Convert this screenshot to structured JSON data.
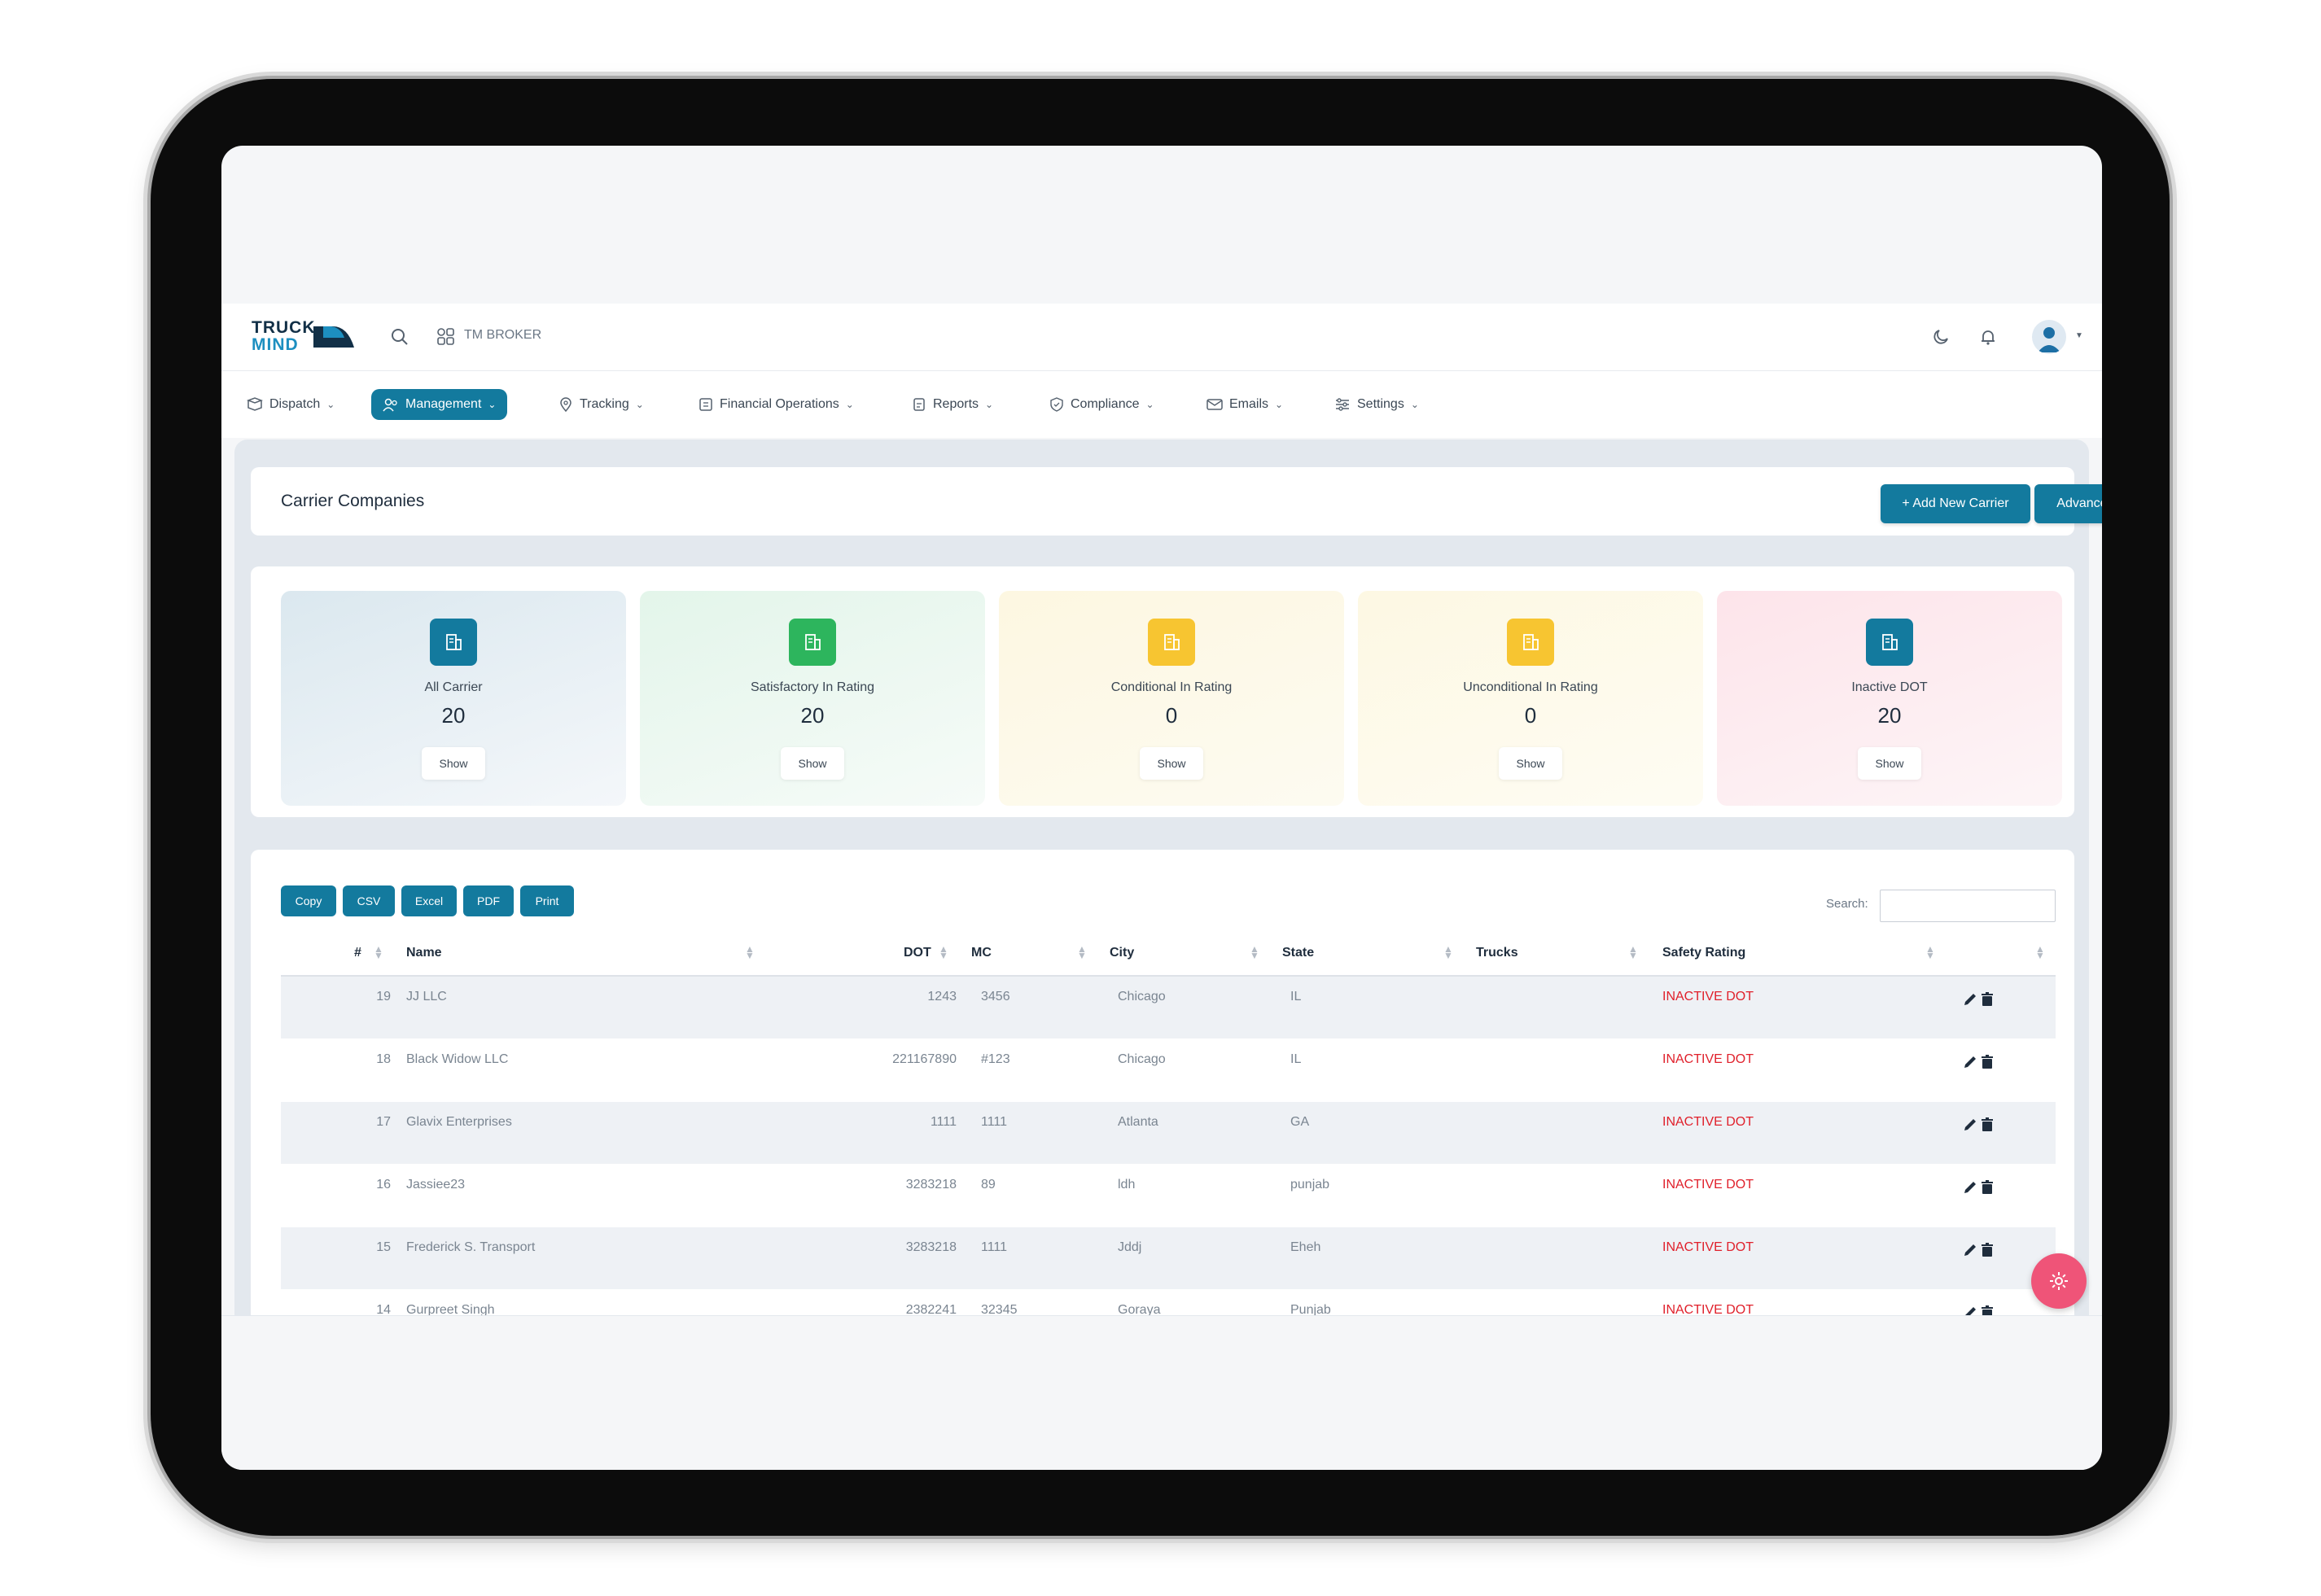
{
  "header": {
    "logo_line1": "TRUCK",
    "logo_line2": "MIND",
    "broker_label": "TM BROKER"
  },
  "nav": {
    "items": [
      {
        "label": "Dispatch",
        "icon": "truck-icon"
      },
      {
        "label": "Management",
        "icon": "people-icon",
        "active": true
      },
      {
        "label": "Tracking",
        "icon": "map-pin-icon"
      },
      {
        "label": "Financial Operations",
        "icon": "invoice-icon"
      },
      {
        "label": "Reports",
        "icon": "report-icon"
      },
      {
        "label": "Compliance",
        "icon": "shield-icon"
      },
      {
        "label": "Emails",
        "icon": "mail-icon"
      },
      {
        "label": "Settings",
        "icon": "sliders-icon"
      }
    ]
  },
  "page": {
    "title": "Carrier Companies",
    "add_button": "+ Add New Carrier",
    "advance_button": "Advance Search"
  },
  "stats": [
    {
      "label": "All Carrier",
      "value": "20",
      "button": "Show",
      "color": "#137a9e"
    },
    {
      "label": "Satisfactory In Rating",
      "value": "20",
      "button": "Show",
      "color": "#2db55d"
    },
    {
      "label": "Conditional In Rating",
      "value": "0",
      "button": "Show",
      "color": "#f7c531"
    },
    {
      "label": "Unconditional In Rating",
      "value": "0",
      "button": "Show",
      "color": "#f7c531"
    },
    {
      "label": "Inactive DOT",
      "value": "20",
      "button": "Show",
      "color": "#137a9e"
    }
  ],
  "table": {
    "export_buttons": [
      "Copy",
      "CSV",
      "Excel",
      "PDF",
      "Print"
    ],
    "search_label": "Search:",
    "columns": [
      "#",
      "Name",
      "DOT",
      "MC",
      "City",
      "State",
      "Trucks",
      "Safety Rating"
    ],
    "rows": [
      {
        "num": "19",
        "name": "JJ LLC",
        "dot": "1243",
        "mc": "3456",
        "city": "Chicago",
        "state": "IL",
        "trucks": "",
        "rating": "INACTIVE DOT"
      },
      {
        "num": "18",
        "name": "Black Widow LLC",
        "dot": "221167890",
        "mc": "#123",
        "city": "Chicago",
        "state": "IL",
        "trucks": "",
        "rating": "INACTIVE DOT"
      },
      {
        "num": "17",
        "name": "Glavix Enterprises",
        "dot": "1111",
        "mc": "1111",
        "city": "Atlanta",
        "state": "GA",
        "trucks": "",
        "rating": "INACTIVE DOT"
      },
      {
        "num": "16",
        "name": "Jassiee23",
        "dot": "3283218",
        "mc": "89",
        "city": "ldh",
        "state": "punjab",
        "trucks": "",
        "rating": "INACTIVE DOT"
      },
      {
        "num": "15",
        "name": "Frederick S. Transport",
        "dot": "3283218",
        "mc": "1111",
        "city": "Jddj",
        "state": "Eheh",
        "trucks": "",
        "rating": "INACTIVE DOT"
      },
      {
        "num": "14",
        "name": "Gurpreet Singh",
        "dot": "2382241",
        "mc": "32345",
        "city": "Goraya",
        "state": "Punjab",
        "trucks": "",
        "rating": "INACTIVE DOT"
      }
    ]
  },
  "colors": {
    "accent": "#137a9e",
    "danger": "#e0202b",
    "fab": "#ef5478"
  }
}
